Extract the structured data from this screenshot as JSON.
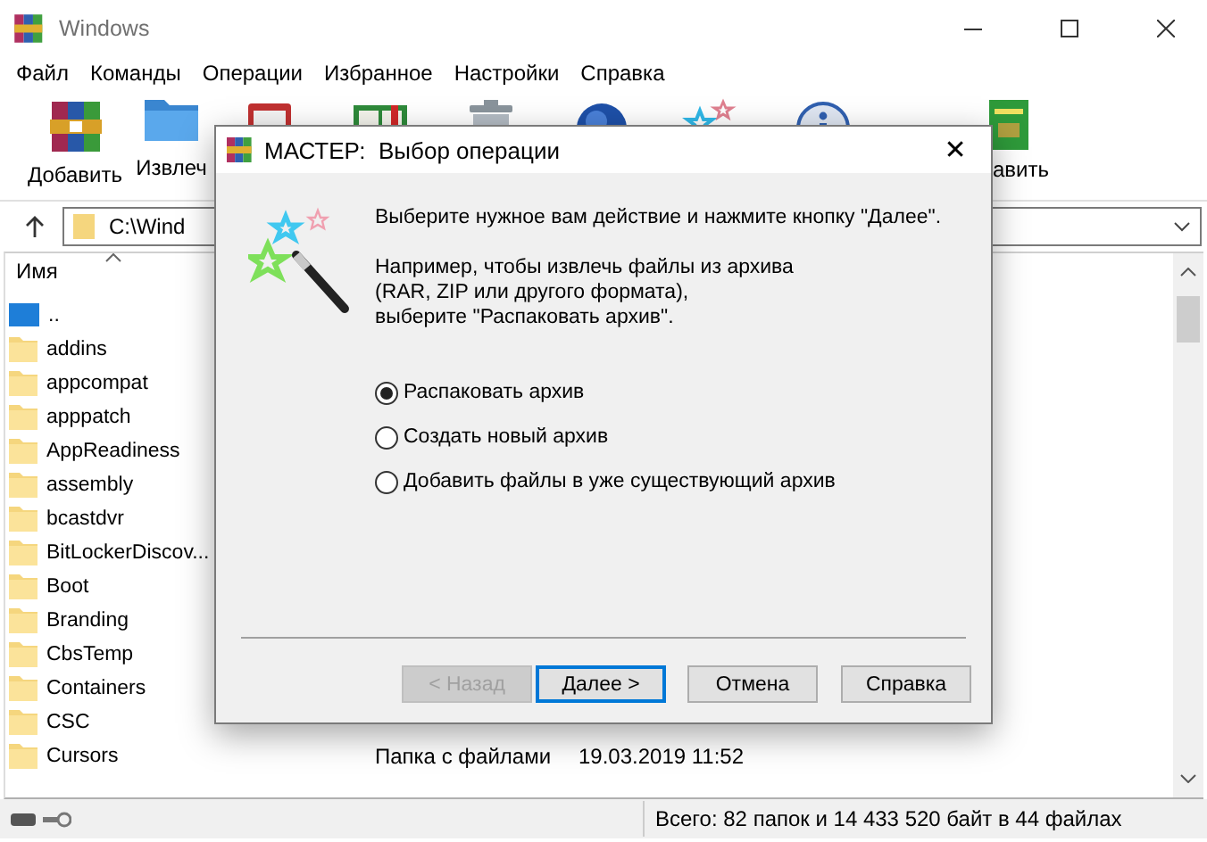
{
  "window": {
    "title": "Windows"
  },
  "menu": [
    "Файл",
    "Команды",
    "Операции",
    "Избранное",
    "Настройки",
    "Справка"
  ],
  "toolbar": [
    "Добавить",
    "Извлеч",
    "авить"
  ],
  "address": {
    "value": "C:\\Wind"
  },
  "file_list": {
    "columns": [
      "Имя"
    ],
    "rows": [
      {
        "name": "..",
        "kind": "up"
      },
      {
        "name": "addins",
        "kind": "folder"
      },
      {
        "name": "appcompat",
        "kind": "folder"
      },
      {
        "name": "apppatch",
        "kind": "folder"
      },
      {
        "name": "AppReadiness",
        "kind": "folder"
      },
      {
        "name": "assembly",
        "kind": "folder"
      },
      {
        "name": "bcastdvr",
        "kind": "folder"
      },
      {
        "name": "BitLockerDiscov...",
        "kind": "folder"
      },
      {
        "name": "Boot",
        "kind": "folder"
      },
      {
        "name": "Branding",
        "kind": "folder"
      },
      {
        "name": "CbsTemp",
        "kind": "folder"
      },
      {
        "name": "Containers",
        "kind": "folder"
      },
      {
        "name": "CSC",
        "kind": "folder"
      },
      {
        "name": "Cursors",
        "kind": "folder",
        "type": "Папка с файлами",
        "modified": "19.03.2019 11:52"
      }
    ]
  },
  "status_bar": {
    "text": "Всего: 82 папок и 14 433 520 байт в 44 файлах"
  },
  "dialog": {
    "title": "МАСТЕР:  Выбор операции",
    "close": "✕",
    "intro": "Выберите нужное вам действие и нажмите кнопку \"Далее\".",
    "hint": [
      "Например, чтобы извлечь файлы из архива",
      "(RAR, ZIP или другого формата),",
      "выберите \"Распаковать архив\"."
    ],
    "options": [
      {
        "label": "Распаковать архив",
        "selected": true
      },
      {
        "label": "Создать новый архив",
        "selected": false
      },
      {
        "label": "Добавить файлы в уже существующий архив",
        "selected": false
      }
    ],
    "buttons": [
      {
        "label": "< Назад",
        "disabled": true,
        "default": false
      },
      {
        "label": "Далее >",
        "disabled": false,
        "default": true
      },
      {
        "label": "Отмена",
        "disabled": false,
        "default": false
      },
      {
        "label": "Справка",
        "disabled": false,
        "default": false
      }
    ]
  }
}
